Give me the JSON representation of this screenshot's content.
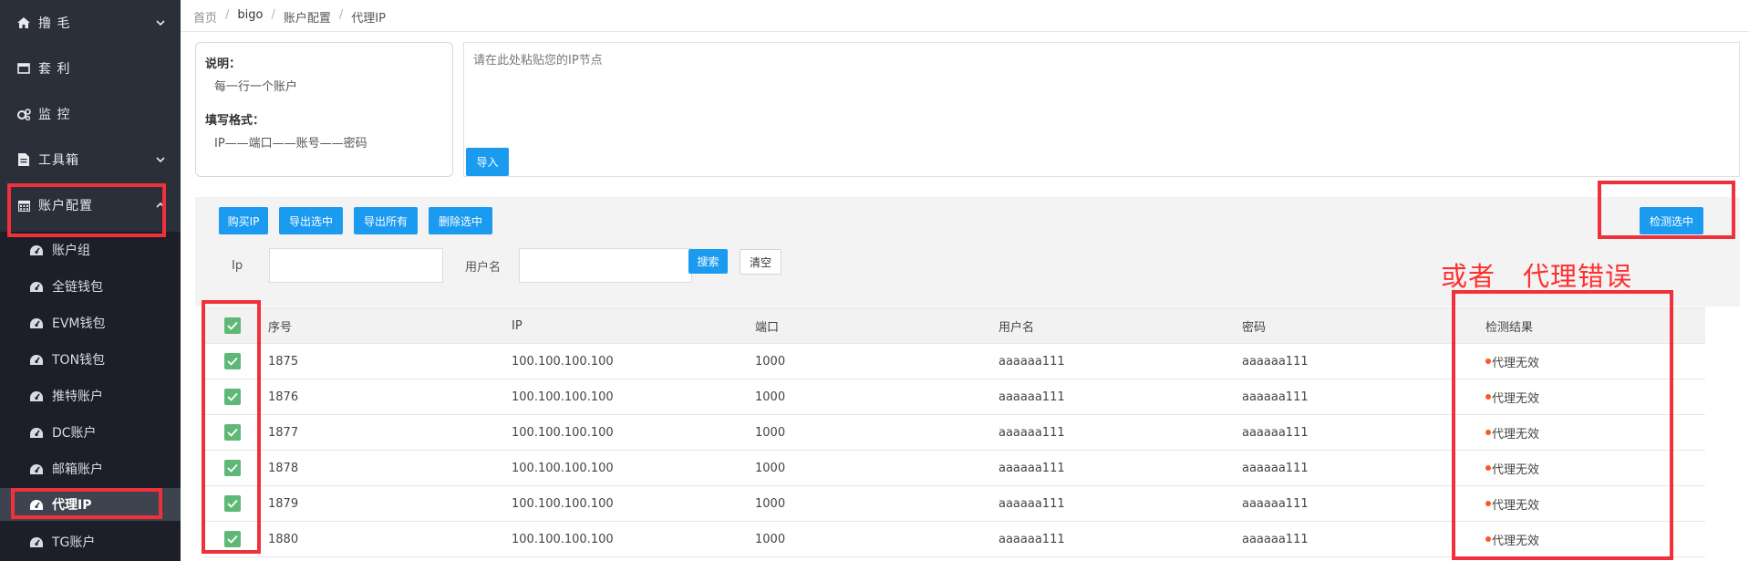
{
  "sidebar": {
    "menu": [
      {
        "label": "撸 毛",
        "icon": "home-icon",
        "has_chevron": true
      },
      {
        "label": "套 利",
        "icon": "window-icon",
        "has_chevron": false
      },
      {
        "label": "监 控",
        "icon": "gears-icon",
        "has_chevron": false
      },
      {
        "label": "工具箱",
        "icon": "file-icon",
        "has_chevron": true
      },
      {
        "label": "账户配置",
        "icon": "calendar-icon",
        "has_chevron": true
      }
    ],
    "submenu": [
      {
        "label": "账户组",
        "icon": "dashboard-icon"
      },
      {
        "label": "全链钱包",
        "icon": "dashboard-icon"
      },
      {
        "label": "EVM钱包",
        "icon": "dashboard-icon"
      },
      {
        "label": "TON钱包",
        "icon": "dashboard-icon"
      },
      {
        "label": "推特账户",
        "icon": "dashboard-icon"
      },
      {
        "label": "DC账户",
        "icon": "dashboard-icon"
      },
      {
        "label": "邮箱账户",
        "icon": "dashboard-icon"
      },
      {
        "label": "代理IP",
        "icon": "dashboard-icon",
        "active": true
      },
      {
        "label": "TG账户",
        "icon": "dashboard-icon"
      }
    ]
  },
  "breadcrumb": [
    "首页",
    "bigo",
    "账户配置",
    "代理IP"
  ],
  "info": {
    "title1": "说明：",
    "text1": "每一行一个账户",
    "title2": "填写格式：",
    "text2": "IP——端口——账号——密码"
  },
  "paste": {
    "placeholder": "请在此处粘贴您的IP节点"
  },
  "import_label": "导入",
  "toolbar": [
    "购买IP",
    "导出选中",
    "导出所有",
    "删除选中"
  ],
  "check_label": "检测选中",
  "search": {
    "ip_label": "Ip",
    "user_label": "用户名",
    "search_label": "搜索",
    "clear_label": "清空"
  },
  "annotation": "或者　代理错误",
  "table": {
    "headers": [
      "序号",
      "IP",
      "端口",
      "用户名",
      "密码",
      "检测结果"
    ],
    "rows": [
      {
        "id": "1875",
        "ip": "100.100.100.100",
        "port": "1000",
        "user": "aaaaaa111",
        "pass": "aaaaaa111",
        "result": "代理无效"
      },
      {
        "id": "1876",
        "ip": "100.100.100.100",
        "port": "1000",
        "user": "aaaaaa111",
        "pass": "aaaaaa111",
        "result": "代理无效"
      },
      {
        "id": "1877",
        "ip": "100.100.100.100",
        "port": "1000",
        "user": "aaaaaa111",
        "pass": "aaaaaa111",
        "result": "代理无效"
      },
      {
        "id": "1878",
        "ip": "100.100.100.100",
        "port": "1000",
        "user": "aaaaaa111",
        "pass": "aaaaaa111",
        "result": "代理无效"
      },
      {
        "id": "1879",
        "ip": "100.100.100.100",
        "port": "1000",
        "user": "aaaaaa111",
        "pass": "aaaaaa111",
        "result": "代理无效"
      },
      {
        "id": "1880",
        "ip": "100.100.100.100",
        "port": "1000",
        "user": "aaaaaa111",
        "pass": "aaaaaa111",
        "result": "代理无效"
      }
    ]
  },
  "colors": {
    "sidebar": "#2b2f3a",
    "accent": "#1b9bf0",
    "checkbox": "#5fb878",
    "status_dot": "#ff5722",
    "annotation": "#f0303a"
  }
}
